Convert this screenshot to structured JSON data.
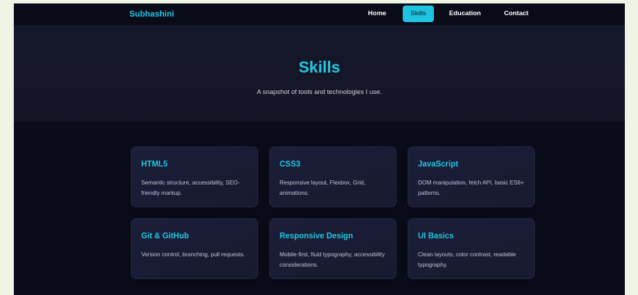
{
  "brand": "Subhashini",
  "nav": {
    "items": [
      {
        "label": "Home",
        "active": false
      },
      {
        "label": "Skills",
        "active": true
      },
      {
        "label": "Education",
        "active": false
      },
      {
        "label": "Contact",
        "active": false
      }
    ]
  },
  "hero": {
    "title": "Skills",
    "subtitle": "A snapshot of tools and technologies I use."
  },
  "skills": [
    {
      "title": "HTML5",
      "description": "Semantic structure, accessibility, SEO-friendly markup."
    },
    {
      "title": "CSS3",
      "description": "Responsive layout, Flexbox, Grid, animations."
    },
    {
      "title": "JavaScript",
      "description": "DOM manipulation, fetch API, basic ES6+ patterns."
    },
    {
      "title": "Git & GitHub",
      "description": "Version control, branching, pull requests."
    },
    {
      "title": "Responsive Design",
      "description": "Mobile-first, fluid typography, accessibility considerations."
    },
    {
      "title": "UI Basics",
      "description": "Clean layouts, color contrast, readable typography."
    }
  ],
  "colors": {
    "accent": "#1fc8e3",
    "background": "#0b0c1b",
    "card": "#1b1e38",
    "page_margin": "#eef5e4"
  }
}
